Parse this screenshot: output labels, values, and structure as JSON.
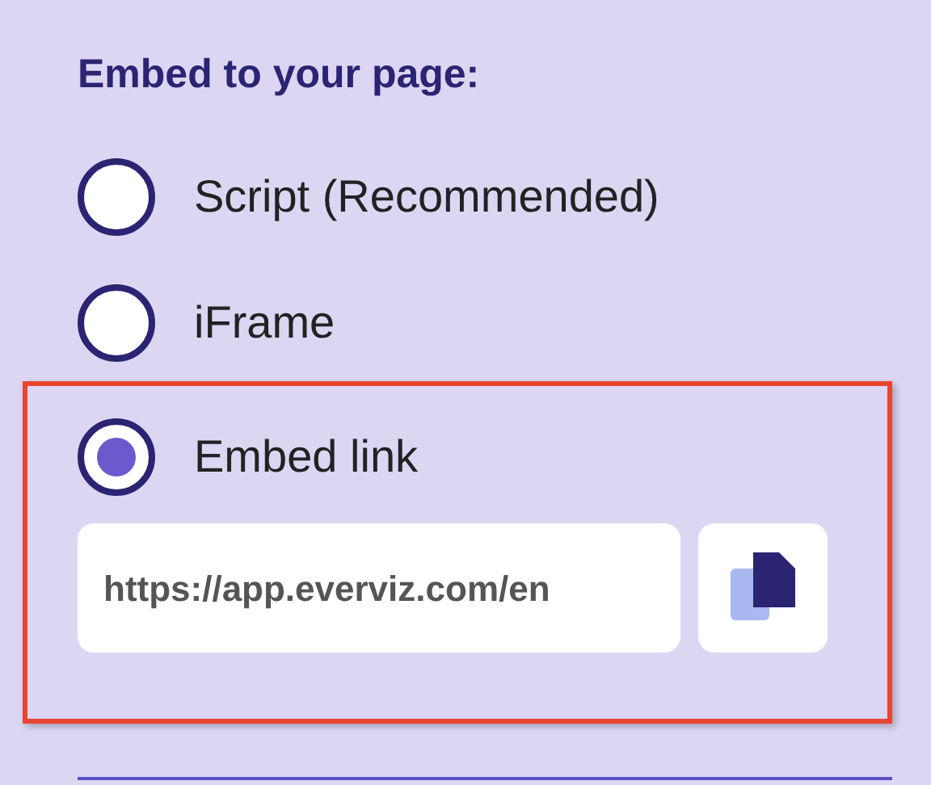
{
  "heading": "Embed to your page:",
  "options": [
    {
      "label": "Script (Recommended)",
      "selected": false,
      "highlighted": false
    },
    {
      "label": "iFrame",
      "selected": false,
      "highlighted": false
    },
    {
      "label": "Embed link",
      "selected": true,
      "highlighted": true
    }
  ],
  "link_field": {
    "value": "https://app.everviz.com/en"
  }
}
